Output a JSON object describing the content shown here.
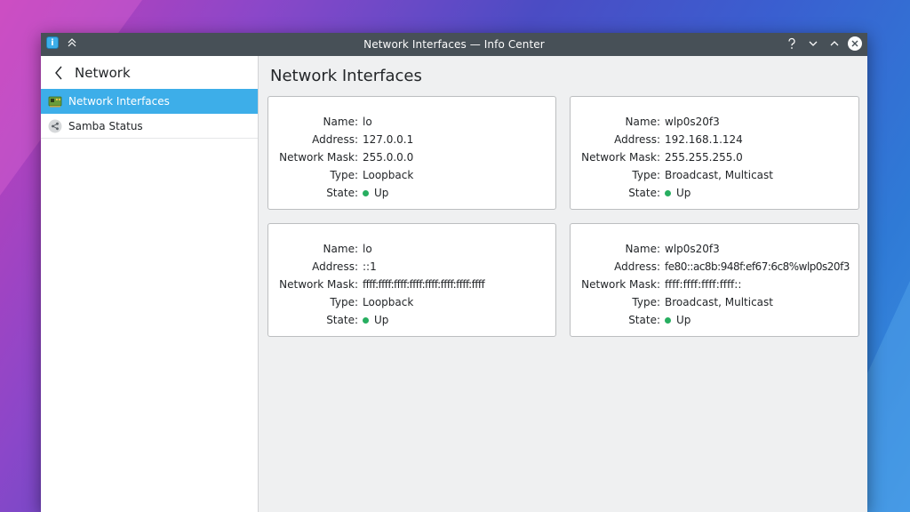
{
  "window": {
    "title": "Network Interfaces — Info Center"
  },
  "sidebar": {
    "header": "Network",
    "items": [
      {
        "label": "Network Interfaces",
        "icon": "network-card-icon",
        "active": true
      },
      {
        "label": "Samba Status",
        "icon": "share-icon",
        "active": false
      }
    ]
  },
  "main": {
    "title": "Network Interfaces",
    "labels": {
      "name": "Name:",
      "address": "Address:",
      "mask": "Network Mask:",
      "type": "Type:",
      "state": "State:"
    },
    "cards": [
      {
        "name": "lo",
        "address": "127.0.0.1",
        "mask": "255.0.0.0",
        "type": "Loopback",
        "state": "Up"
      },
      {
        "name": "wlp0s20f3",
        "address": "192.168.1.124",
        "mask": "255.255.255.0",
        "type": "Broadcast, Multicast",
        "state": "Up"
      },
      {
        "name": "lo",
        "address": "::1",
        "mask": "ffff:ffff:ffff:ffff:ffff:ffff:ffff:ffff",
        "type": "Loopback",
        "state": "Up"
      },
      {
        "name": "wlp0s20f3",
        "address": "fe80::ac8b:948f:ef67:6c8%wlp0s20f3",
        "mask": "ffff:ffff:ffff:ffff::",
        "type": "Broadcast, Multicast",
        "state": "Up"
      }
    ]
  },
  "colors": {
    "accent": "#3daee9",
    "titlebar": "#475057",
    "state_up": "#27ae60"
  }
}
